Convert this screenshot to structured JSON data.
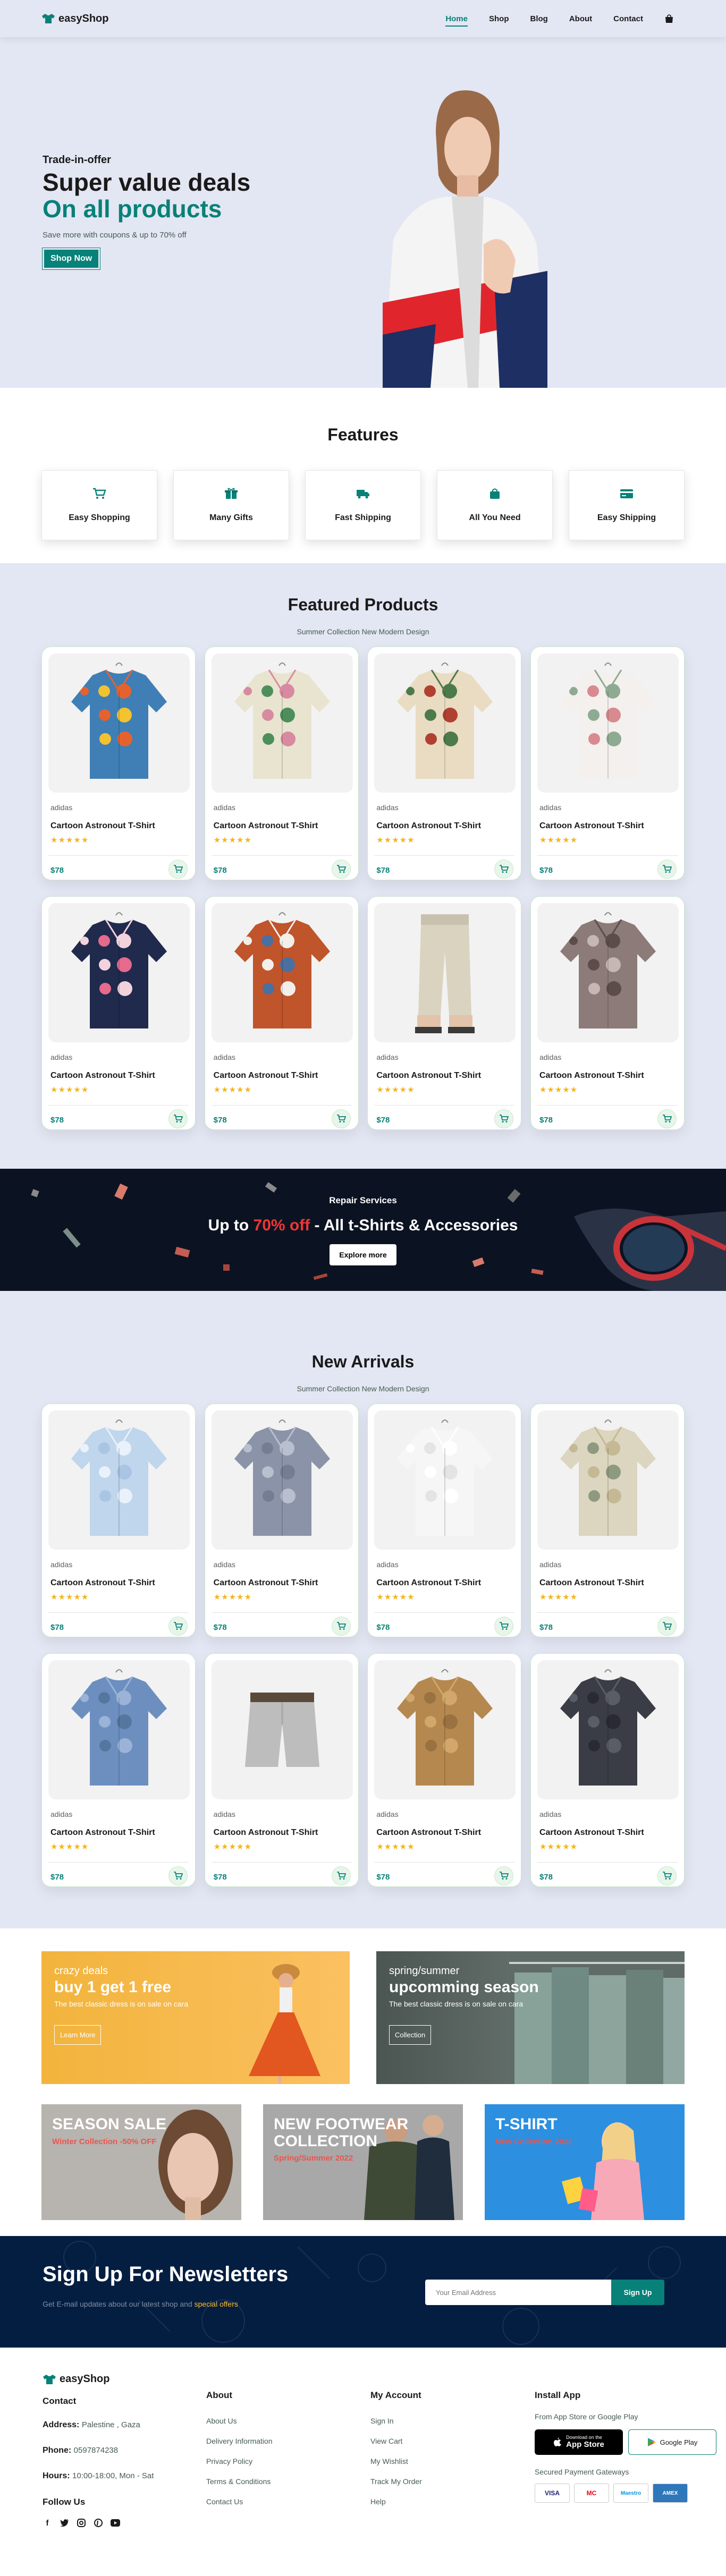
{
  "header": {
    "logo_text": "easyShop",
    "nav": [
      "Home",
      "Shop",
      "Blog",
      "About",
      "Contact"
    ],
    "active_nav": "Home",
    "cart_icon": "shopping-bag-icon"
  },
  "hero": {
    "eyebrow": "Trade-in-offer",
    "headline": "Super value deals",
    "highlight": "On all products",
    "description": "Save more with coupons & up to 70% off",
    "button": "Shop Now"
  },
  "features": {
    "title": "Features",
    "items": [
      {
        "label": "Easy Shopping",
        "icon": "cart-icon"
      },
      {
        "label": "Many Gifts",
        "icon": "gifts-icon"
      },
      {
        "label": "Fast Shipping",
        "icon": "truck-icon"
      },
      {
        "label": "All You Need",
        "icon": "bag-icon"
      },
      {
        "label": "Easy Shipping",
        "icon": "credit-card-icon"
      }
    ]
  },
  "featured": {
    "title": "Featured Products",
    "subtitle": "Summer Collection New Modern Design",
    "products": [
      {
        "brand": "adidas",
        "name": "Cartoon Astronout T-Shirt",
        "price": "$78",
        "rating": 5,
        "image": "hawaiian-shirt-colorful"
      },
      {
        "brand": "adidas",
        "name": "Cartoon Astronout T-Shirt",
        "price": "$78",
        "rating": 5,
        "image": "hawaiian-shirt-leaves"
      },
      {
        "brand": "adidas",
        "name": "Cartoon Astronout T-Shirt",
        "price": "$78",
        "rating": 5,
        "image": "hawaiian-shirt-floral-red"
      },
      {
        "brand": "adidas",
        "name": "Cartoon Astronout T-Shirt",
        "price": "$78",
        "rating": 5,
        "image": "white-floral-shirt"
      },
      {
        "brand": "adidas",
        "name": "Cartoon Astronout T-Shirt",
        "price": "$78",
        "rating": 5,
        "image": "navy-floral-shirt"
      },
      {
        "brand": "adidas",
        "name": "Cartoon Astronout T-Shirt",
        "price": "$78",
        "rating": 5,
        "image": "orange-denim-shirt"
      },
      {
        "brand": "adidas",
        "name": "Cartoon Astronout T-Shirt",
        "price": "$78",
        "rating": 5,
        "image": "linen-trousers"
      },
      {
        "brand": "adidas",
        "name": "Cartoon Astronout T-Shirt",
        "price": "$78",
        "rating": 5,
        "image": "paisley-blouse"
      }
    ]
  },
  "banner": {
    "eyebrow": "Repair Services",
    "heading_pre": "Up to ",
    "heading_highlight": "70% off",
    "heading_post": " - All t-Shirts & Accessories",
    "button": "Explore more"
  },
  "arrivals": {
    "title": "New Arrivals",
    "subtitle": "Summer Collection New Modern Design",
    "products": [
      {
        "brand": "adidas",
        "name": "Cartoon Astronout T-Shirt",
        "price": "$78",
        "rating": 5,
        "image": "light-blue-shirt"
      },
      {
        "brand": "adidas",
        "name": "Cartoon Astronout T-Shirt",
        "price": "$78",
        "rating": 5,
        "image": "grey-check-shirt"
      },
      {
        "brand": "adidas",
        "name": "Cartoon Astronout T-Shirt",
        "price": "$78",
        "rating": 5,
        "image": "white-shirt"
      },
      {
        "brand": "adidas",
        "name": "Cartoon Astronout T-Shirt",
        "price": "$78",
        "rating": 5,
        "image": "beige-print-shirt"
      },
      {
        "brand": "adidas",
        "name": "Cartoon Astronout T-Shirt",
        "price": "$78",
        "rating": 5,
        "image": "denim-shirt"
      },
      {
        "brand": "adidas",
        "name": "Cartoon Astronout T-Shirt",
        "price": "$78",
        "rating": 5,
        "image": "grey-shorts"
      },
      {
        "brand": "adidas",
        "name": "Cartoon Astronout T-Shirt",
        "price": "$78",
        "rating": 5,
        "image": "tan-overshirt"
      },
      {
        "brand": "adidas",
        "name": "Cartoon Astronout T-Shirt",
        "price": "$78",
        "rating": 5,
        "image": "dark-shirt"
      }
    ]
  },
  "promos": {
    "left": {
      "eyebrow": "crazy deals",
      "title": "buy 1 get 1 free",
      "text": "The best classic dress is on sale on cara",
      "button": "Learn More"
    },
    "right": {
      "eyebrow": "spring/summer",
      "title": "upcomming season",
      "text": "The best classic dress is on sale on cara",
      "button": "Collection"
    },
    "small": [
      {
        "title": "SEASON SALE",
        "subtitle": "Winter Collection -50% OFF"
      },
      {
        "title": "NEW FOOTWEAR COLLECTION",
        "subtitle": "Spring/Summer 2022"
      },
      {
        "title": "T-SHIRT",
        "subtitle": "New Collection 2022"
      }
    ]
  },
  "newsletter": {
    "title": "Sign Up For Newsletters",
    "text_pre": "Get E-mail updates about our latest shop and ",
    "text_highlight": "special offers",
    "placeholder": "Your Email Address",
    "button": "Sign Up"
  },
  "footer": {
    "logo_text": "easyShop",
    "contact_title": "Contact",
    "address_label": "Address:",
    "address": "Palestine , Gaza",
    "phone_label": "Phone:",
    "phone": "0597874238",
    "hours_label": "Hours:",
    "hours": "10:00-18:00, Mon - Sat",
    "follow": "Follow Us",
    "about_title": "About",
    "about_links": [
      "About Us",
      "Delivery Information",
      "Privacy Policy",
      "Terms & Conditions",
      "Contact Us"
    ],
    "account_title": "My Account",
    "account_links": [
      "Sign In",
      "View Cart",
      "My Wishlist",
      "Track My Order",
      "Help"
    ],
    "app_title": "Install App",
    "app_text": "From App Store or Google Play",
    "app_store_small": "Download on the",
    "app_store": "App Store",
    "google_play": "Google Play",
    "payment_text": "Secured Payment Gateways",
    "cards": [
      "VISA",
      "MC",
      "Maestro",
      "AMEX"
    ]
  }
}
